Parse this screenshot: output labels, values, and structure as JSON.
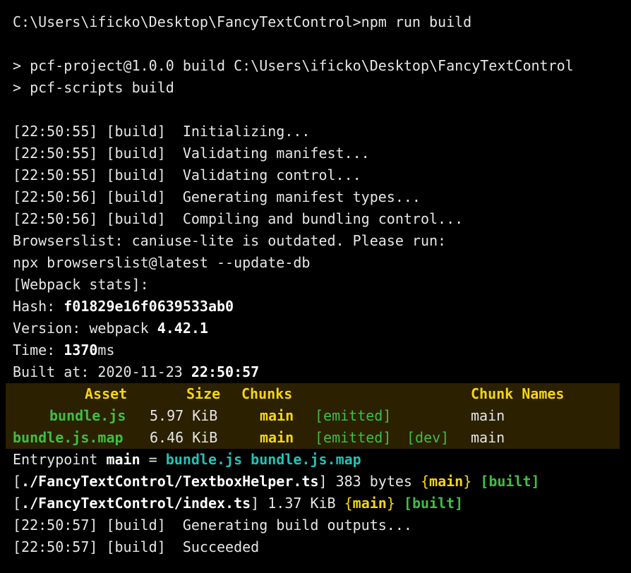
{
  "terminal": {
    "command_line": "C:\\Users\\ificko\\Desktop\\FancyTextControl>npm run build",
    "script_lines": [
      "> pcf-project@1.0.0 build C:\\Users\\ificko\\Desktop\\FancyTextControl",
      "> pcf-scripts build"
    ],
    "build_steps": [
      "[22:50:55] [build]  Initializing...",
      "[22:50:55] [build]  Validating manifest...",
      "[22:50:55] [build]  Validating control...",
      "[22:50:56] [build]  Generating manifest types...",
      "[22:50:56] [build]  Compiling and bundling control..."
    ],
    "browserslist_warning": "Browserslist: caniuse-lite is outdated. Please run:",
    "browserslist_command": "npx browserslist@latest --update-db",
    "webpack_stats_header": "[Webpack stats]:",
    "hash_label": "Hash: ",
    "hash_value": "f01829e16f0639533ab0",
    "version_label": "Version: webpack ",
    "version_value": "4.42.1",
    "time_label": "Time: ",
    "time_value": "1370",
    "time_unit": "ms",
    "built_at_label": "Built at: 2020-11-23 ",
    "built_at_time": "22:50:57",
    "asset_table": {
      "headers": {
        "asset": "Asset",
        "size": "Size",
        "chunks": "Chunks",
        "chunk_names": "Chunk Names"
      },
      "rows": [
        {
          "asset": "bundle.js",
          "size": "5.97 KiB",
          "chunks": "main",
          "status": "[emitted]",
          "extra": "",
          "chunk_name": "main"
        },
        {
          "asset": "bundle.js.map",
          "size": "6.46 KiB",
          "chunks": "main",
          "status": "[emitted]",
          "extra": "[dev]",
          "chunk_name": "main"
        }
      ]
    },
    "entrypoint": {
      "label": "Entrypoint ",
      "name": "main",
      "equals": " = ",
      "files": "bundle.js bundle.js.map"
    },
    "modules": [
      {
        "open": "[",
        "path": "./FancyTextControl/TextboxHelper.ts",
        "close": "]",
        "size": " 383 bytes ",
        "chunk_open": "{",
        "chunk": "main",
        "chunk_close": "}",
        "status": " [built]"
      },
      {
        "open": "[",
        "path": "./FancyTextControl/index.ts",
        "close": "]",
        "size": " 1.37 KiB ",
        "chunk_open": "{",
        "chunk": "main",
        "chunk_close": "}",
        "status": " [built]"
      }
    ],
    "final_steps": [
      "[22:50:57] [build]  Generating build outputs...",
      "[22:50:57] [build]  Succeeded"
    ]
  }
}
